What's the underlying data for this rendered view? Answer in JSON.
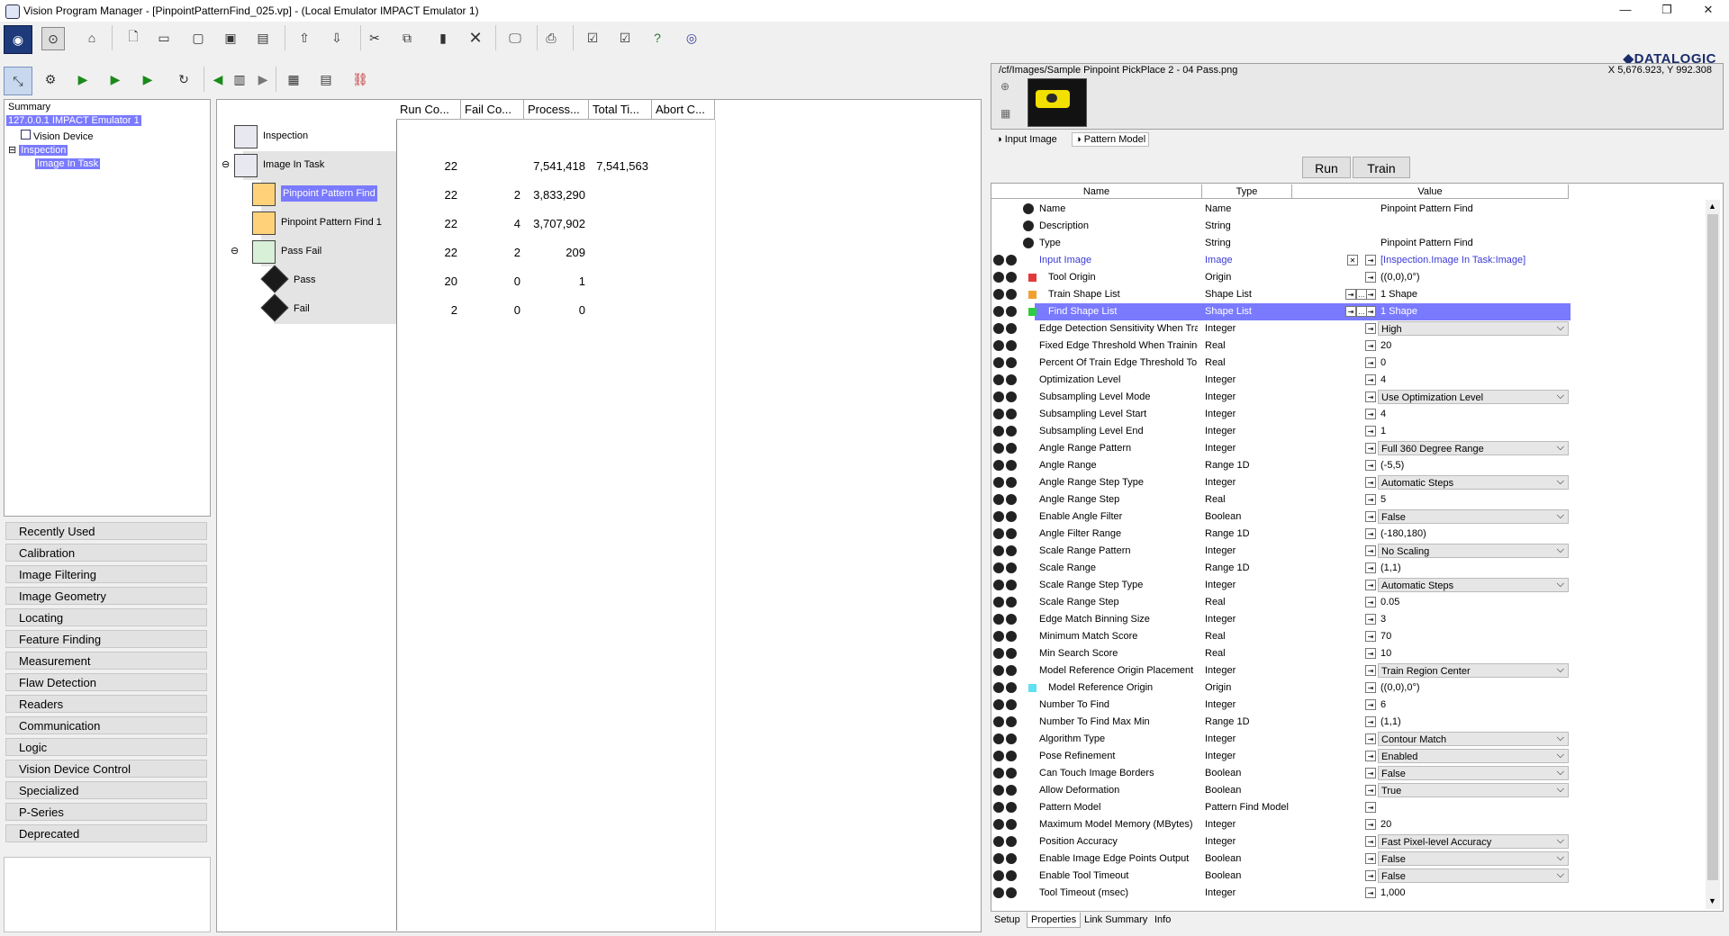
{
  "window": {
    "title": "Vision Program Manager - [PinpointPatternFind_025.vp] - (Local Emulator IMPACT Emulator 1)",
    "controls": [
      "—",
      "❐",
      "✕"
    ]
  },
  "brand": {
    "logo": "◆DATALOGIC"
  },
  "tree": {
    "summary": "Summary",
    "emulator": "127.0.0.1 IMPACT Emulator 1",
    "vision_device": "Vision Device",
    "inspection": "Inspection",
    "image_in_task": "Image In Task"
  },
  "categories": [
    "Recently Used",
    "Calibration",
    "Image Filtering",
    "Image Geometry",
    "Locating",
    "Feature Finding",
    "Measurement",
    "Flaw Detection",
    "Readers",
    "Communication",
    "Logic",
    "Vision Device Control",
    "Specialized",
    "P-Series",
    "Deprecated"
  ],
  "grid": {
    "headers": [
      "Run Co...",
      "Fail Co...",
      "Process...",
      "Total Ti...",
      "Abort C..."
    ],
    "rows": [
      {
        "name": "Inspection",
        "run": "",
        "fail": "",
        "process": "",
        "total": ""
      },
      {
        "name": "Image In Task",
        "run": "22",
        "fail": "",
        "process": "7,541,418",
        "total": "7,541,563"
      },
      {
        "name": "Pinpoint Pattern Find",
        "run": "22",
        "fail": "2",
        "process": "3,833,290",
        "total": ""
      },
      {
        "name": "Pinpoint Pattern Find 1",
        "run": "22",
        "fail": "4",
        "process": "3,707,902",
        "total": ""
      },
      {
        "name": "Pass Fail",
        "run": "22",
        "fail": "2",
        "process": "209",
        "total": ""
      },
      {
        "name": "Pass",
        "run": "20",
        "fail": "0",
        "process": "1",
        "total": ""
      },
      {
        "name": "Fail",
        "run": "2",
        "fail": "0",
        "process": "0",
        "total": ""
      }
    ]
  },
  "image_panel": {
    "path": "/cf/Images/Sample Pinpoint PickPlace 2 - 04 Pass.png",
    "coords": "X 5,676.923,  Y 992.308",
    "tabs": [
      "Input Image",
      "Pattern Model"
    ]
  },
  "actions": {
    "run": "Run",
    "train": "Train"
  },
  "props": {
    "headers": [
      "Name",
      "Type",
      "Value"
    ],
    "rows": [
      {
        "n": "Name",
        "t": "Name",
        "v": "Pinpoint Pattern Find",
        "dd": false
      },
      {
        "n": "Description",
        "t": "String",
        "v": "",
        "dd": false
      },
      {
        "n": "Type",
        "t": "String",
        "v": "Pinpoint Pattern Find",
        "dd": false
      },
      {
        "n": "Input Image",
        "t": "Image",
        "v": "[Inspection.Image In Task:Image]",
        "dd": false
      },
      {
        "n": "Tool Origin",
        "t": "Origin",
        "v": "((0,0),0°)",
        "dd": false
      },
      {
        "n": "Train Shape List",
        "t": "Shape List",
        "v": "1 Shape",
        "dd": false
      },
      {
        "n": "Find Shape List",
        "t": "Shape List",
        "v": "1 Shape",
        "dd": false
      },
      {
        "n": "Edge Detection Sensitivity When Training",
        "t": "Integer",
        "v": "High",
        "dd": true
      },
      {
        "n": "Fixed Edge Threshold When Training",
        "t": "Real",
        "v": "20",
        "dd": false
      },
      {
        "n": "Percent Of Train Edge Threshold To Use",
        "t": "Real",
        "v": "0",
        "dd": false
      },
      {
        "n": "Optimization Level",
        "t": "Integer",
        "v": "4",
        "dd": false
      },
      {
        "n": "Subsampling Level Mode",
        "t": "Integer",
        "v": "Use Optimization Level",
        "dd": true
      },
      {
        "n": "Subsampling Level Start",
        "t": "Integer",
        "v": "4",
        "dd": false
      },
      {
        "n": "Subsampling Level End",
        "t": "Integer",
        "v": "1",
        "dd": false
      },
      {
        "n": "Angle Range Pattern",
        "t": "Integer",
        "v": "Full 360 Degree Range",
        "dd": true
      },
      {
        "n": "Angle Range",
        "t": "Range 1D",
        "v": "(-5,5)",
        "dd": false
      },
      {
        "n": "Angle Range Step Type",
        "t": "Integer",
        "v": "Automatic Steps",
        "dd": true
      },
      {
        "n": "Angle Range Step",
        "t": "Real",
        "v": "5",
        "dd": false
      },
      {
        "n": "Enable Angle Filter",
        "t": "Boolean",
        "v": "False",
        "dd": true
      },
      {
        "n": "Angle Filter Range",
        "t": "Range 1D",
        "v": "(-180,180)",
        "dd": false
      },
      {
        "n": "Scale Range Pattern",
        "t": "Integer",
        "v": "No Scaling",
        "dd": true
      },
      {
        "n": "Scale Range",
        "t": "Range 1D",
        "v": "(1,1)",
        "dd": false
      },
      {
        "n": "Scale Range Step Type",
        "t": "Integer",
        "v": "Automatic Steps",
        "dd": true
      },
      {
        "n": "Scale Range Step",
        "t": "Real",
        "v": "0.05",
        "dd": false
      },
      {
        "n": "Edge Match Binning Size",
        "t": "Integer",
        "v": "3",
        "dd": false
      },
      {
        "n": "Minimum Match Score",
        "t": "Real",
        "v": "70",
        "dd": false
      },
      {
        "n": "Min Search Score",
        "t": "Real",
        "v": "10",
        "dd": false
      },
      {
        "n": "Model Reference Origin Placement",
        "t": "Integer",
        "v": "Train Region Center",
        "dd": true
      },
      {
        "n": "Model Reference Origin",
        "t": "Origin",
        "v": "((0,0),0°)",
        "dd": false
      },
      {
        "n": "Number To Find",
        "t": "Integer",
        "v": "6",
        "dd": false
      },
      {
        "n": "Number To Find Max Min",
        "t": "Range 1D",
        "v": "(1,1)",
        "dd": false
      },
      {
        "n": "Algorithm Type",
        "t": "Integer",
        "v": "Contour Match",
        "dd": true
      },
      {
        "n": "Pose Refinement",
        "t": "Integer",
        "v": "Enabled",
        "dd": true
      },
      {
        "n": "Can Touch Image Borders",
        "t": "Boolean",
        "v": "False",
        "dd": true
      },
      {
        "n": "Allow Deformation",
        "t": "Boolean",
        "v": "True",
        "dd": true
      },
      {
        "n": "Pattern Model",
        "t": "Pattern Find Model",
        "v": "",
        "dd": false
      },
      {
        "n": "Maximum Model Memory (MBytes)",
        "t": "Integer",
        "v": "20",
        "dd": false
      },
      {
        "n": "Position Accuracy",
        "t": "Integer",
        "v": "Fast Pixel-level Accuracy",
        "dd": true
      },
      {
        "n": "Enable Image Edge Points Output",
        "t": "Boolean",
        "v": "False",
        "dd": true
      },
      {
        "n": "Enable Tool Timeout",
        "t": "Boolean",
        "v": "False",
        "dd": true
      },
      {
        "n": "Tool Timeout (msec)",
        "t": "Integer",
        "v": "1,000",
        "dd": false
      }
    ]
  },
  "bottom_tabs": [
    "Setup",
    "Properties",
    "Link Summary",
    "Info"
  ],
  "colors": {
    "selection": "#7a7aff",
    "accent": "#1a2d6b"
  }
}
